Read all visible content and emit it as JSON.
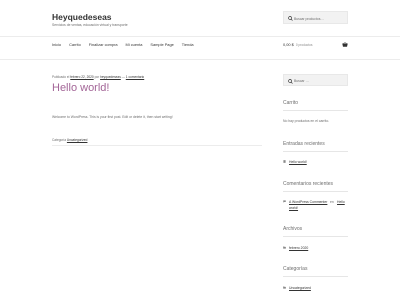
{
  "header": {
    "site_title": "Heyquedeseas",
    "site_description": "Servicios de ventas, educación virtual y transporte",
    "search_placeholder": "Buscar productos…"
  },
  "nav": {
    "items": [
      "Inicio",
      "Carrito",
      "Finalizar compra",
      "Mi cuenta",
      "Sample Page",
      "Tienda"
    ]
  },
  "cart": {
    "amount": "0,00 $",
    "count": "0 productos"
  },
  "post": {
    "meta_prefix": "Publicado el",
    "date": "febrero 22, 2020",
    "by": "por",
    "author": "heyquedeseas",
    "separator": "—",
    "comments": "1 comentario",
    "title": "Hello world!",
    "content": "Welcome to WordPress. This is your first post. Edit or delete it, then start writing!",
    "category_label": "Categoría",
    "category": "Uncategorized"
  },
  "sidebar": {
    "search_placeholder": "Buscar …",
    "cart_heading": "Carrito",
    "cart_empty": "No hay productos en el carrito.",
    "recent_posts_heading": "Entradas recientes",
    "recent_post": "Hello world!",
    "recent_comments_heading": "Comentarios recientes",
    "comment_author": "A WordPress Commenter",
    "comment_on": "en",
    "comment_post": "Hello",
    "comment_post_2": "world!",
    "archives_heading": "Archivos",
    "archive_item": "febrero 2020",
    "categories_heading": "Categorías",
    "category_item": "Uncategorized"
  },
  "colors": {
    "accent": "#a36597",
    "text": "#6d6d6d",
    "heading": "#333333"
  }
}
